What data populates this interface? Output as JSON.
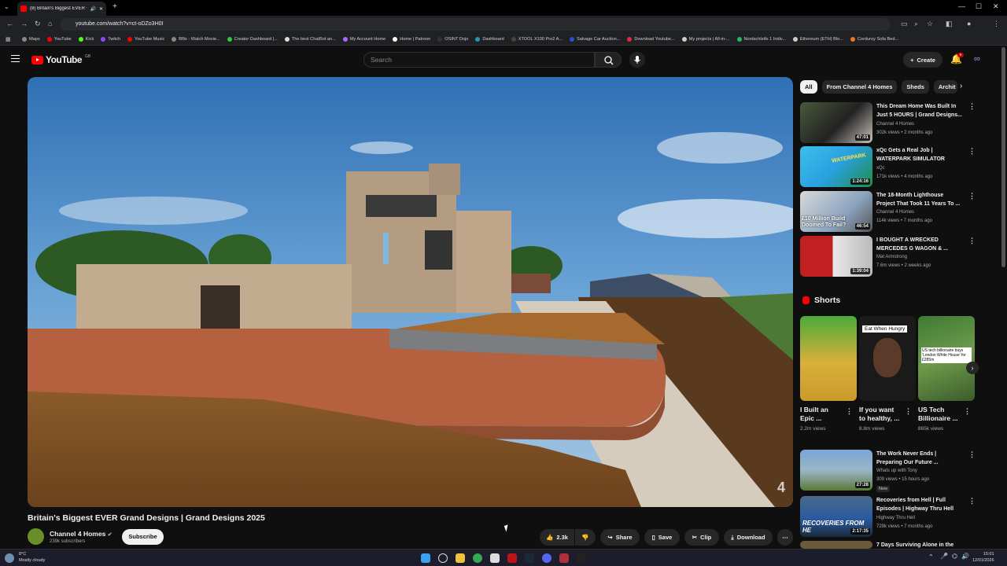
{
  "browser": {
    "tab_title": "(8) Britain's Biggest EVER G",
    "url": "youtube.com/watch?v=ct-oDZo3H0I",
    "bookmarks": [
      "Maps",
      "YouTube",
      "Kick",
      "Twitch",
      "YouTube Music",
      "Bflix - Watch Movie...",
      "Creator Dashboard |...",
      "The best ChatBot an...",
      "My Account Home",
      "Home | Patreon",
      "OSINT Dojo",
      "Dashboard",
      "XTOOL X100 Pro2 A...",
      "Salvage Car Auction...",
      "Download Youtube...",
      "My projects | All-in-...",
      "Nordschleife 1 Indiv...",
      "Ethereum (ETH) Blo...",
      "Corduroy Sofa Bed..."
    ]
  },
  "header": {
    "logo_text": "YouTube",
    "logo_country": "GB",
    "search_placeholder": "Search",
    "create_label": "Create",
    "notification_count": "9"
  },
  "video": {
    "title": "Britain's Biggest EVER Grand Designs | Grand Designs 2025",
    "channel": "Channel 4 Homes",
    "subscribers": "239k subscribers",
    "subscribe_label": "Subscribe",
    "likes": "2.3k",
    "share_label": "Share",
    "save_label": "Save",
    "clip_label": "Clip",
    "download_label": "Download",
    "watermark": "4"
  },
  "sidebar": {
    "chips": [
      "All",
      "From Channel 4 Homes",
      "Sheds",
      "Archit"
    ],
    "recommendations": [
      {
        "title1": "This Dream Home Was Built In",
        "title2": "Just 5 HOURS | Grand Designs...",
        "channel": "Channel 4 Homes",
        "meta": "302k views • 2 months ago",
        "duration": "47:01",
        "thumb_overlay": ""
      },
      {
        "title1": "xQc Gets a Real Job |",
        "title2": "WATERPARK SIMULATOR",
        "channel": "xQc",
        "meta": "171k views • 4 months ago",
        "duration": "1:24:16",
        "thumb_overlay": "WATERPARK"
      },
      {
        "title1": "The 18-Month Lighthouse",
        "title2": "Project That Took 11 Years To ...",
        "channel": "Channel 4 Homes",
        "meta": "114k views • 7 months ago",
        "duration": "46:54",
        "thumb_overlay": "£10 Million Build Doomed To Fail?"
      },
      {
        "title1": "I BOUGHT A WRECKED",
        "title2": "MERCEDES G WAGON & ...",
        "channel": "Mat Armstrong",
        "meta": "7.6m views • 2 weeks ago",
        "duration": "1:39:04",
        "thumb_overlay": ""
      }
    ],
    "shorts_heading": "Shorts",
    "shorts": [
      {
        "title1": "I Built an",
        "title2": "Epic ...",
        "views": "2.2m views",
        "overlay": ""
      },
      {
        "title1": "If you want",
        "title2": "to healthy, ...",
        "views": "8.8m views",
        "overlay": "Eat When Hungry"
      },
      {
        "title1": "US Tech",
        "title2": "Billionaire ...",
        "views": "865k views",
        "overlay": "US tech billionaire buys 'London White House' for £285m"
      }
    ],
    "more": [
      {
        "title1": "The Work Never Ends |",
        "title2": "Preparing Our Future ...",
        "channel": "Whats up with Tony",
        "meta": "309 views • 15 hours ago",
        "duration": "27:28",
        "badge": "New"
      },
      {
        "title1": "Recoveries from Hell | Full",
        "title2": "Episodes | Highway Thru Hell",
        "channel": "Highway Thru Hell",
        "meta": "729k views • 7 months ago",
        "duration": "2:17:35",
        "overlay": "RECOVERIES FROM HE"
      },
      {
        "title1": "7 Days Surviving Alone in the",
        "title2": "",
        "channel": "",
        "meta": "",
        "duration": ""
      }
    ]
  },
  "taskbar": {
    "temp": "8°C",
    "weather": "Mostly cloudy",
    "time": "15:01",
    "date": "12/01/2026"
  }
}
